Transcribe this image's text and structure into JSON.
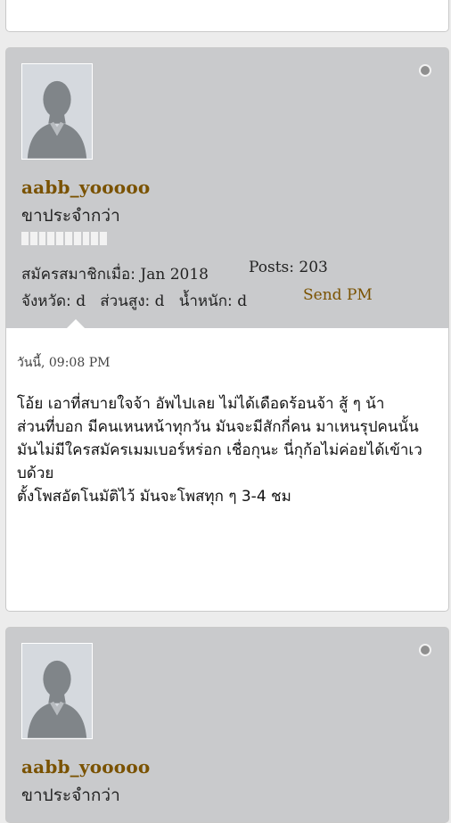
{
  "posts": [
    {
      "username": "aabb_yooooo",
      "rank": "ขาประจำกว่า",
      "rank_level": 1.0,
      "joined_label": "สมัครสมาชิกเมื่อ:",
      "joined_value": "Jan 2018",
      "posts_label": "Posts:",
      "posts_value": "203",
      "province_label": "จังหวัด:",
      "province_value": "d",
      "height_label": "ส่วนสูง:",
      "height_value": "d",
      "weight_label": "น้ำหนัก:",
      "weight_value": "d",
      "send_pm": "Send PM",
      "date": "วันนี้, 09:08 PM",
      "body_lines": [
        "โอ้ย เอาที่สบายใจจ้า อัพไปเลย ไม่ได้เดือดร้อนจ้า สู้ ๆ น้า",
        "ส่วนที่บอก มีคนเหนหน้าทุกวัน มันจะมีสักกี่คน มาเหนรุปคนนั้น",
        "มันไม่มีใครสมัครเมมเบอร์หร่อก เชื่อกุนะ นี่กุก้อไม่ค่อยได้เข้าเวบด้วย",
        "ตั้งโพสอัตโนมัติไว้ มันจะโพสทุก ๆ 3-4 ชม"
      ]
    },
    {
      "username": "aabb_yooooo",
      "rank": "ขาประจำกว่า"
    }
  ]
}
